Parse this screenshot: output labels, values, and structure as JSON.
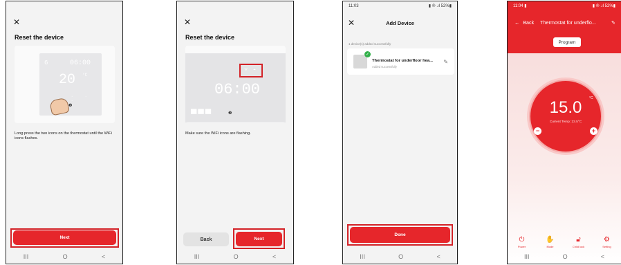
{
  "screen1": {
    "close_icon": "close-icon",
    "title": "Reset the device",
    "display": {
      "time": "06:00",
      "temp": "20",
      "unit": "°C",
      "marker": "6"
    },
    "description": "Long press the two icons on the thermostat until the WiFi icons flashes.",
    "next_label": "Next",
    "nav": [
      "III",
      "O",
      "<"
    ]
  },
  "screen2": {
    "title": "Reset the device",
    "display": {
      "time": "06:00"
    },
    "description": "Make sure the WiFi icons are flashing.",
    "back_label": "Back",
    "next_label": "Next",
    "nav": [
      "III",
      "O",
      "<"
    ]
  },
  "screen3": {
    "status_time": "11:03",
    "status_right": "▮ ✇ .ıl 52%▮",
    "header": "Add Device",
    "added_text": "1 device(s) added successfully",
    "device_name": "Thermostat for underfloor hea...",
    "device_status": "Added successfully",
    "done_label": "Done",
    "nav": [
      "III",
      "O",
      "<"
    ]
  },
  "screen4": {
    "status_time": "11:04 ▮",
    "status_right": "▮ ✇ .ıl 52%▮",
    "back_label": "Back",
    "title": "Thermostat for underflo...",
    "program_label": "Program",
    "temperature": "15.0",
    "unit": "°C",
    "current_temp": "Current Temp: 23.5°C",
    "tabs": [
      {
        "label": "Power",
        "icon": "power-icon"
      },
      {
        "label": "Mode",
        "icon": "hand-icon"
      },
      {
        "label": "Child lock",
        "icon": "lock-icon"
      },
      {
        "label": "Setting",
        "icon": "gear-icon"
      }
    ],
    "nav": [
      "III",
      "O",
      "<"
    ]
  },
  "colors": {
    "accent": "#e6262b",
    "highlight": "#d32227",
    "success": "#32b04a"
  }
}
